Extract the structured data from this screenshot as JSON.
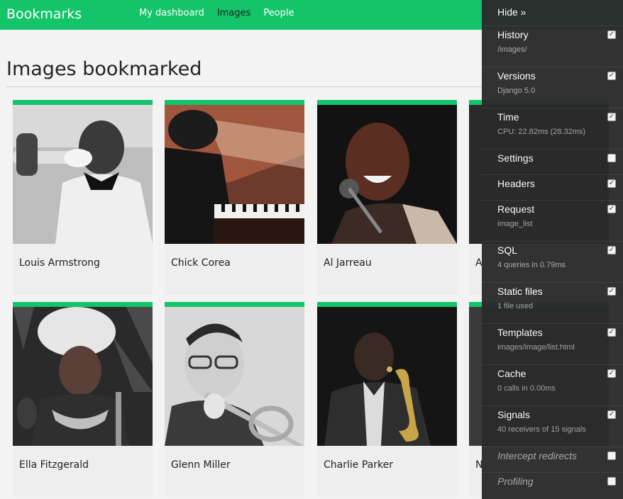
{
  "header": {
    "brand": "Bookmarks",
    "nav": [
      "My dashboard",
      "Images",
      "People"
    ]
  },
  "main": {
    "title": "Images bookmarked",
    "cards": [
      {
        "caption": "Louis Armstrong"
      },
      {
        "caption": "Chick Corea"
      },
      {
        "caption": "Al Jarreau"
      },
      {
        "caption": "A"
      },
      {
        "caption": "Ella Fitzgerald"
      },
      {
        "caption": "Glenn Miller"
      },
      {
        "caption": "Charlie Parker"
      },
      {
        "caption": "N"
      }
    ]
  },
  "toolbar": {
    "hide_label": "Hide »",
    "panels": [
      {
        "title": "History",
        "subtitle": "/images/",
        "checked": true
      },
      {
        "title": "Versions",
        "subtitle": "Django 5.0",
        "checked": true
      },
      {
        "title": "Time",
        "subtitle": "CPU: 22.82ms (28.32ms)",
        "checked": true
      },
      {
        "title": "Settings",
        "subtitle": "",
        "checked": false
      },
      {
        "title": "Headers",
        "subtitle": "",
        "checked": true
      },
      {
        "title": "Request",
        "subtitle": "image_list",
        "checked": true
      },
      {
        "title": "SQL",
        "subtitle": "4 queries in 0.79ms",
        "checked": true
      },
      {
        "title": "Static files",
        "subtitle": "1 file used",
        "checked": true
      },
      {
        "title": "Templates",
        "subtitle": "images/image/list.html",
        "checked": true
      },
      {
        "title": "Cache",
        "subtitle": "0 calls in 0.00ms",
        "checked": true
      },
      {
        "title": "Signals",
        "subtitle": "40 receivers of 15 signals",
        "checked": true
      },
      {
        "title": "Intercept redirects",
        "subtitle": "",
        "checked": false
      },
      {
        "title": "Profiling",
        "subtitle": "",
        "checked": false
      }
    ]
  },
  "colors": {
    "accent": "#14c46a",
    "toolbar_bg": "#2b2b2b"
  }
}
